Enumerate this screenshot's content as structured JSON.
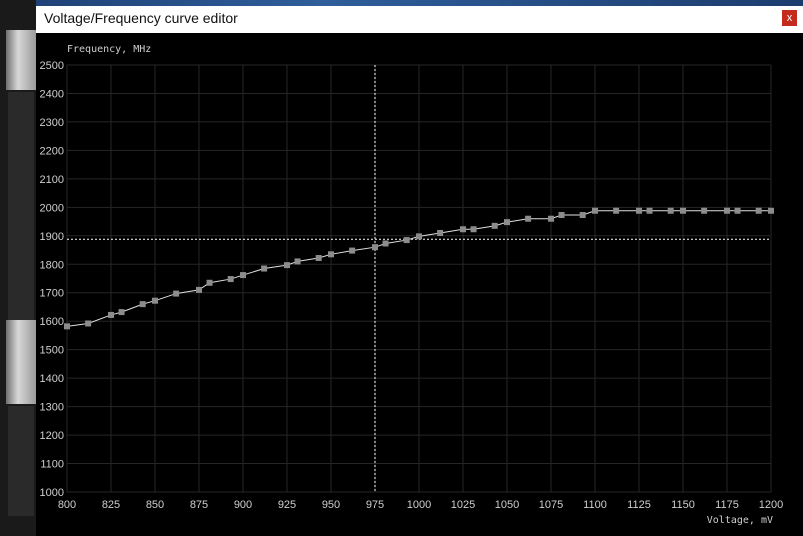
{
  "window": {
    "title": "Voltage/Frequency curve editor",
    "close_label": "x"
  },
  "colors": {
    "background": "#000000",
    "grid": "#262626",
    "curve": "#e0e0e0",
    "point": "#8c8c8c",
    "text": "#cfcfcf"
  },
  "chart_data": {
    "type": "line",
    "ylabel": "Frequency, MHz",
    "xlabel": "Voltage, mV",
    "xlim": [
      800,
      1200
    ],
    "ylim": [
      1000,
      2500
    ],
    "x_ticks": [
      800,
      825,
      850,
      875,
      900,
      925,
      950,
      975,
      1000,
      1025,
      1050,
      1075,
      1100,
      1125,
      1150,
      1175,
      1200
    ],
    "y_ticks": [
      1000,
      1100,
      1200,
      1300,
      1400,
      1500,
      1600,
      1700,
      1800,
      1900,
      2000,
      2100,
      2200,
      2300,
      2400,
      2500
    ],
    "grid": true,
    "cursor": {
      "voltage": 975,
      "frequency": 1888
    },
    "x": [
      800,
      812,
      825,
      831,
      843,
      850,
      862,
      875,
      881,
      893,
      900,
      912,
      925,
      931,
      943,
      950,
      962,
      975,
      981,
      993,
      1000,
      1012,
      1025,
      1031,
      1043,
      1050,
      1062,
      1075,
      1081,
      1093,
      1100,
      1112,
      1125,
      1131,
      1143,
      1150,
      1162,
      1175,
      1181,
      1193,
      1200
    ],
    "y": [
      1582,
      1592,
      1622,
      1632,
      1660,
      1672,
      1697,
      1710,
      1735,
      1748,
      1762,
      1785,
      1797,
      1810,
      1822,
      1835,
      1848,
      1860,
      1873,
      1885,
      1898,
      1910,
      1923,
      1923,
      1935,
      1948,
      1960,
      1960,
      1973,
      1973,
      1988,
      1988,
      1988,
      1988,
      1988,
      1988,
      1988,
      1988,
      1988,
      1988,
      1988
    ]
  }
}
